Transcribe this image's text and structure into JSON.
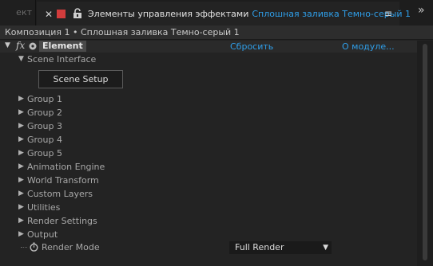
{
  "tabs": {
    "previous_tab_fragment": "ект",
    "active": {
      "title": "Элементы управления эффектами",
      "target": "Сплошная заливка Темно-серый 1",
      "swatch_color": "#d23c3c",
      "close_icon": "close-icon",
      "lock_icon": "lock-icon",
      "menu_icon": "panel-menu-icon"
    },
    "overflow_icon": "double-chevron-right-icon"
  },
  "breadcrumb": "Композиция 1 • Сплошная заливка Темно-серый 1",
  "effect": {
    "name": "Element",
    "reset_label": "Сбросить",
    "about_label": "О модуле...",
    "accent_color": "#2f9ee8"
  },
  "tree": {
    "scene_interface": "Scene Interface",
    "scene_setup_button": "Scene Setup",
    "groups": [
      "Group 1",
      "Group 2",
      "Group 3",
      "Group 4",
      "Group 5",
      "Animation Engine",
      "World Transform",
      "Custom Layers",
      "Utilities",
      "Render Settings",
      "Output"
    ],
    "render_mode": {
      "label": "Render Mode",
      "value": "Full Render"
    }
  }
}
